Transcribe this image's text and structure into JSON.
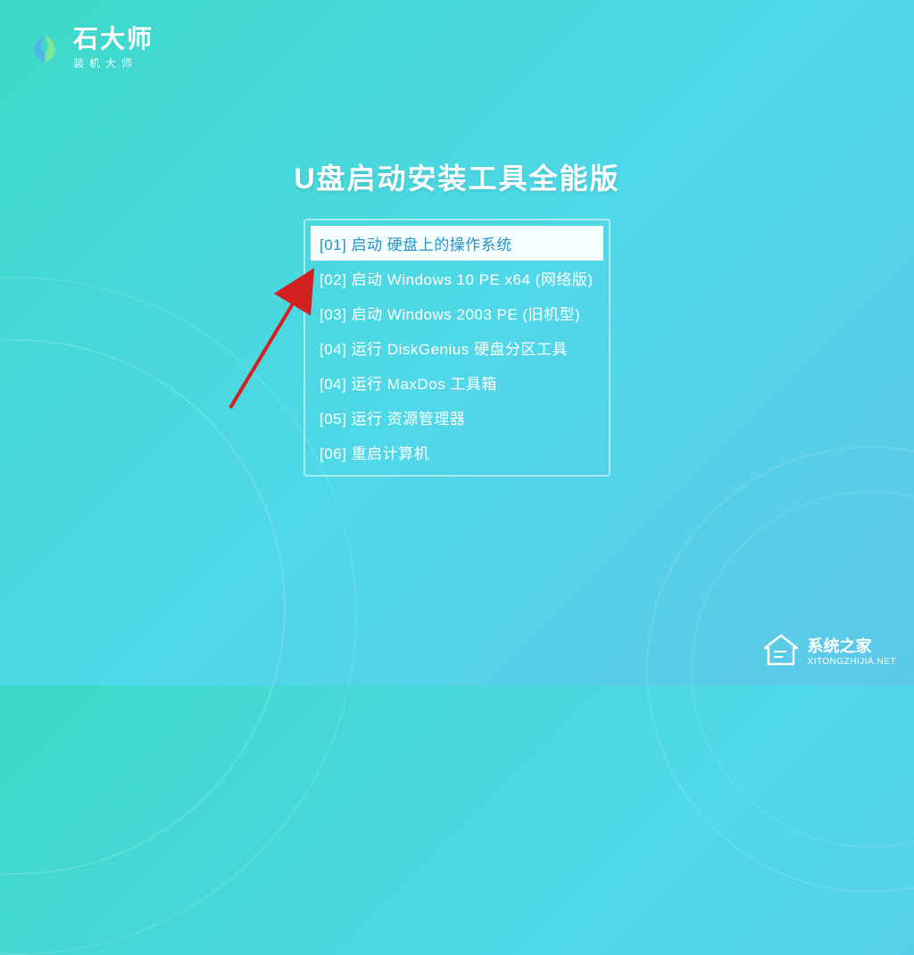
{
  "logo": {
    "title": "石大师",
    "subtitle": "装机大师"
  },
  "main_title": "U盘启动安装工具全能版",
  "menu": {
    "items": [
      {
        "label": "[01] 启动 硬盘上的操作系统",
        "selected": true
      },
      {
        "label": "[02] 启动 Windows 10 PE x64 (网络版)",
        "selected": false
      },
      {
        "label": "[03] 启动 Windows 2003 PE (旧机型)",
        "selected": false
      },
      {
        "label": "[04] 运行 DiskGenius 硬盘分区工具",
        "selected": false
      },
      {
        "label": "[04] 运行 MaxDos 工具箱",
        "selected": false
      },
      {
        "label": "[05] 运行 资源管理器",
        "selected": false
      },
      {
        "label": "[06] 重启计算机",
        "selected": false
      }
    ]
  },
  "watermark": {
    "title": "系统之家",
    "subtitle": "XITONGZHIJIA.NET"
  }
}
